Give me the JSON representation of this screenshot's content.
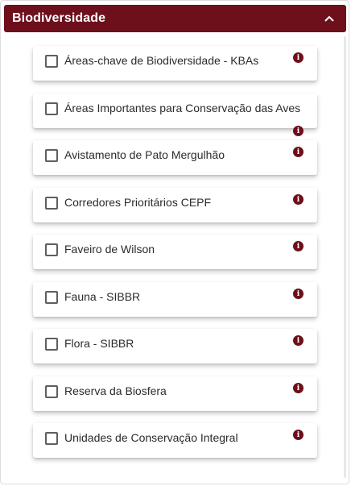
{
  "panel": {
    "title": "Biodiversidade",
    "toggle_icon": "chevron-up-icon",
    "accent_color": "#6e0f1c"
  },
  "layers": [
    {
      "label": "Áreas-chave de Biodiversidade - KBAs",
      "checked": false,
      "info_icon": "info-icon"
    },
    {
      "label": "Áreas Importantes para Conservação das Aves",
      "checked": false,
      "info_icon": "info-icon"
    },
    {
      "label": "Avistamento de Pato Mergulhão",
      "checked": false,
      "info_icon": "info-icon"
    },
    {
      "label": "Corredores Prioritários CEPF",
      "checked": false,
      "info_icon": "info-icon"
    },
    {
      "label": "Faveiro de Wilson",
      "checked": false,
      "info_icon": "info-icon"
    },
    {
      "label": "Fauna - SIBBR",
      "checked": false,
      "info_icon": "info-icon"
    },
    {
      "label": "Flora - SIBBR",
      "checked": false,
      "info_icon": "info-icon"
    },
    {
      "label": "Reserva da Biosfera",
      "checked": false,
      "info_icon": "info-icon"
    },
    {
      "label": "Unidades de Conservação Integral",
      "checked": false,
      "info_icon": "info-icon"
    }
  ]
}
